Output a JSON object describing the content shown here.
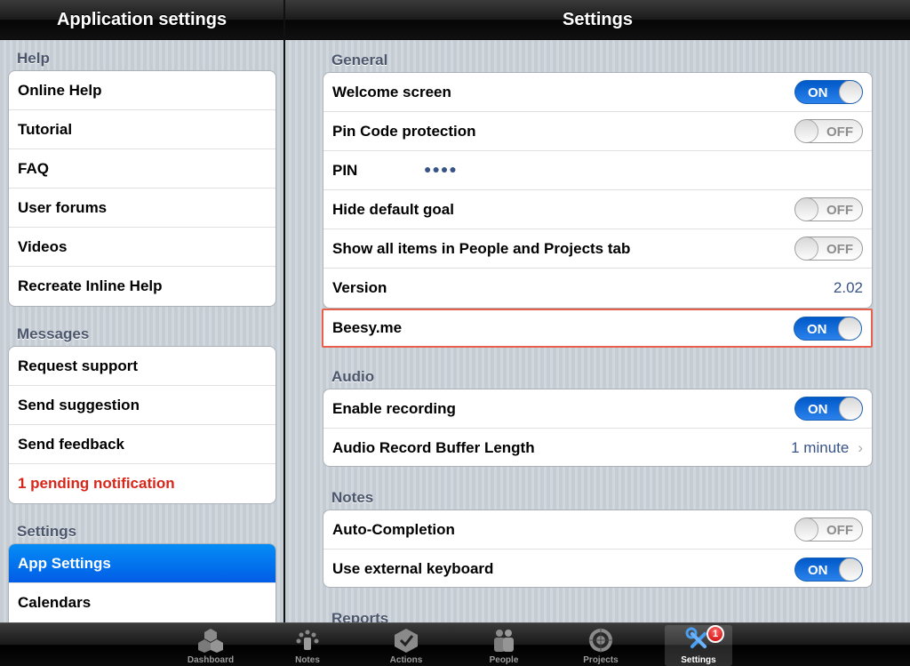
{
  "left_header": {
    "title": "Application settings"
  },
  "right_header": {
    "title": "Settings"
  },
  "sidebar": {
    "help": {
      "title": "Help",
      "items": [
        "Online Help",
        "Tutorial",
        "FAQ",
        "User forums",
        "Videos",
        "Recreate Inline Help"
      ]
    },
    "messages": {
      "title": "Messages",
      "items": [
        "Request support",
        "Send suggestion",
        "Send feedback",
        "1 pending notification"
      ]
    },
    "settings": {
      "title": "Settings",
      "items": [
        "App Settings",
        "Calendars"
      ],
      "selected": "App Settings"
    }
  },
  "general": {
    "title": "General",
    "welcome_screen": {
      "label": "Welcome screen",
      "state": "ON"
    },
    "pin_protection": {
      "label": "Pin Code protection",
      "state": "OFF"
    },
    "pin": {
      "label": "PIN",
      "value": "●●●●"
    },
    "hide_default_goal": {
      "label": "Hide default goal",
      "state": "OFF"
    },
    "show_all_items": {
      "label": "Show all items in People and Projects tab",
      "state": "OFF"
    },
    "version": {
      "label": "Version",
      "value": "2.02"
    },
    "beesy": {
      "label": "Beesy.me",
      "state": "ON"
    }
  },
  "audio": {
    "title": "Audio",
    "enable_recording": {
      "label": "Enable recording",
      "state": "ON"
    },
    "buffer_length": {
      "label": "Audio Record Buffer Length",
      "value": "1 minute"
    }
  },
  "notes": {
    "title": "Notes",
    "auto_completion": {
      "label": "Auto-Completion",
      "state": "OFF"
    },
    "external_keyboard": {
      "label": "Use external keyboard",
      "state": "ON"
    }
  },
  "reports": {
    "title": "Reports"
  },
  "tabbar": {
    "tabs": [
      {
        "label": "Dashboard",
        "icon": "cubes-icon"
      },
      {
        "label": "Notes",
        "icon": "notes-icon"
      },
      {
        "label": "Actions",
        "icon": "actions-icon"
      },
      {
        "label": "People",
        "icon": "people-icon"
      },
      {
        "label": "Projects",
        "icon": "projects-icon"
      },
      {
        "label": "Settings",
        "icon": "wrench-icon",
        "badge": "1"
      }
    ],
    "active": "Settings"
  },
  "colors": {
    "accent": "#015de6",
    "switch_on": "#2b82ec",
    "alert_text": "#d9261b",
    "highlight_border": "#e8604c"
  }
}
